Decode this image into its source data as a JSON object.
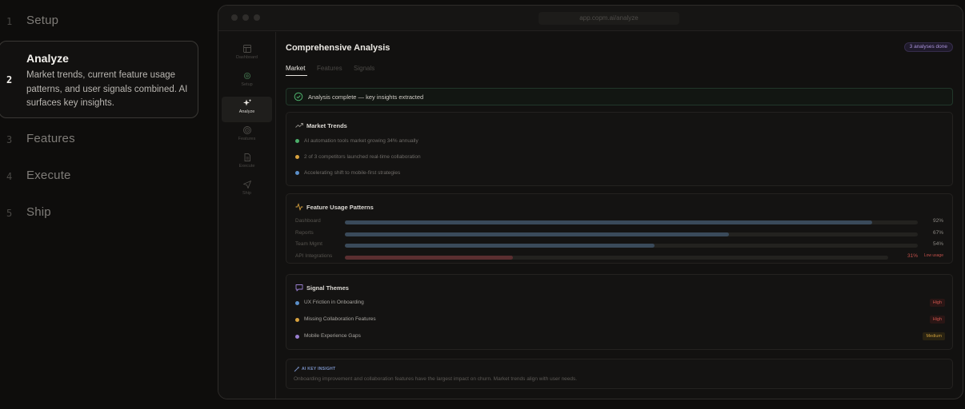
{
  "steps": [
    {
      "num": "1",
      "name": "Setup"
    },
    {
      "num": "2",
      "name": "Analyze",
      "desc": "Market trends, current feature usage patterns, and user signals combined. AI surfaces key insights."
    },
    {
      "num": "3",
      "name": "Features"
    },
    {
      "num": "4",
      "name": "Execute"
    },
    {
      "num": "5",
      "name": "Ship"
    }
  ],
  "browser": {
    "url": "app.copm.ai/analyze"
  },
  "nav": [
    {
      "label": "Dashboard",
      "icon": "layout-icon"
    },
    {
      "label": "Setup",
      "icon": "gear-icon"
    },
    {
      "label": "Analyze",
      "icon": "sparkle-icon"
    },
    {
      "label": "Features",
      "icon": "target-icon"
    },
    {
      "label": "Execute",
      "icon": "document-icon"
    },
    {
      "label": "Ship",
      "icon": "send-icon"
    }
  ],
  "main": {
    "title": "Comprehensive Analysis",
    "badge": "3 analyses done",
    "tabs": [
      "Market",
      "Features",
      "Signals"
    ],
    "banner": "Analysis complete — key insights extracted"
  },
  "trends": {
    "title": "Market Trends",
    "items": [
      {
        "text": "AI automation tools market growing 34% annually",
        "color": "#4caf6a"
      },
      {
        "text": "2 of 3 competitors launched real-time collaboration",
        "color": "#d9a23e"
      },
      {
        "text": "Accelerating shift to mobile-first strategies",
        "color": "#5b8fc9"
      }
    ]
  },
  "usage": {
    "title": "Feature Usage Patterns",
    "rows": [
      {
        "label": "Dashboard",
        "pct": "92%",
        "value": 0.92
      },
      {
        "label": "Reports",
        "pct": "67%",
        "value": 0.67
      },
      {
        "label": "Team Mgmt",
        "pct": "54%",
        "value": 0.54
      },
      {
        "label": "API Integrations",
        "pct": "31%",
        "value": 0.31,
        "tag": "Low usage"
      }
    ]
  },
  "signals": {
    "title": "Signal Themes",
    "items": [
      {
        "name": "UX Friction in Onboarding",
        "severity": "High",
        "color": "#5b8fc9"
      },
      {
        "name": "Missing Collaboration Features",
        "severity": "High",
        "color": "#d9a23e"
      },
      {
        "name": "Mobile Experience Gaps",
        "severity": "Medium",
        "color": "#9a7fd0"
      }
    ]
  },
  "insight": {
    "label": "AI KEY INSIGHT",
    "text": "Onboarding improvement and collaboration features have the largest impact on churn. Market trends align with user needs."
  }
}
